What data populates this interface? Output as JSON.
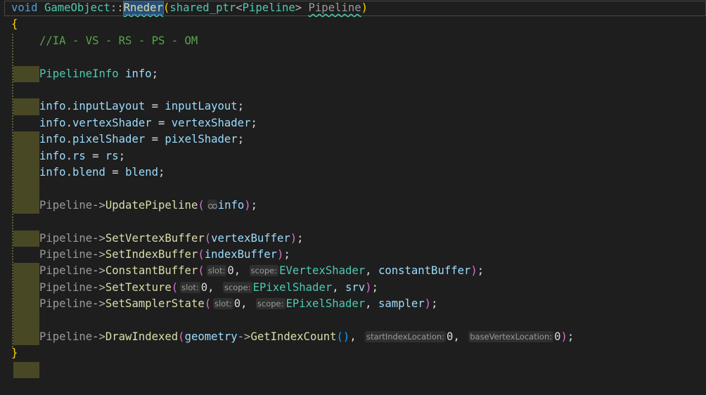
{
  "editor": {
    "signature": {
      "return_type": "void",
      "class_name": "GameObject",
      "scope_op": "::",
      "method_name": "Rneder",
      "open_paren": "(",
      "param_type_template": "shared_ptr",
      "lt": "<",
      "param_type_arg": "Pipeline",
      "gt": ">",
      "param_name": "Pipeline",
      "close_paren": ")"
    },
    "open_brace": "{",
    "close_brace": "}",
    "comment": "//IA - VS - RS - PS - OM",
    "decl": {
      "type": "PipelineInfo",
      "var": "info",
      "semi": ";"
    },
    "assignments": [
      {
        "obj": "info",
        "member": "inputLayout",
        "value": "inputLayout"
      },
      {
        "obj": "info",
        "member": "vertexShader",
        "value": "vertexShader"
      },
      {
        "obj": "info",
        "member": "pixelShader",
        "value": "pixelShader"
      },
      {
        "obj": "info",
        "member": "rs",
        "value": "rs"
      },
      {
        "obj": "info",
        "member": "blend",
        "value": "blend"
      }
    ],
    "receiver": "Pipeline",
    "arrow": "->",
    "update_call": {
      "fn": "UpdatePipeline",
      "arg": "info"
    },
    "set_vertex": {
      "fn": "SetVertexBuffer",
      "arg": "vertexBuffer"
    },
    "set_index": {
      "fn": "SetIndexBuffer",
      "arg": "indexBuffer"
    },
    "constant_buffer": {
      "fn": "ConstantBuffer",
      "hint1": "slot:",
      "val1": "0",
      "hint2": "scope:",
      "val2": "EVertexShader",
      "arg3": "constantBuffer"
    },
    "set_texture": {
      "fn": "SetTexture",
      "hint1": "slot:",
      "val1": "0",
      "hint2": "scope:",
      "val2": "EPixelShader",
      "arg3": "srv"
    },
    "set_sampler": {
      "fn": "SetSamplerState",
      "hint1": "slot:",
      "val1": "0",
      "hint2": "scope:",
      "val2": "EPixelShader",
      "arg3": "sampler"
    },
    "draw_indexed": {
      "fn": "DrawIndexed",
      "obj": "geometry",
      "inner_fn": "GetIndexCount",
      "hint1": "startIndexLocation:",
      "val1": "0",
      "hint2": "baseVertexLocation:",
      "val2": "0"
    },
    "punct": {
      "eq": " = ",
      "dot": ".",
      "semi": ";",
      "comma": ", ",
      "space": " "
    }
  },
  "colors": {
    "background": "#1e1e1e",
    "keyword": "#569cd6",
    "type": "#4ec9b0",
    "function": "#dcdcaa",
    "member": "#9cdcfe",
    "comment": "#57a64a",
    "indent_highlight": "#494825",
    "bracket_gold": "#ffd700",
    "bracket_purple": "#da70d6",
    "bracket_blue": "#179fff"
  }
}
